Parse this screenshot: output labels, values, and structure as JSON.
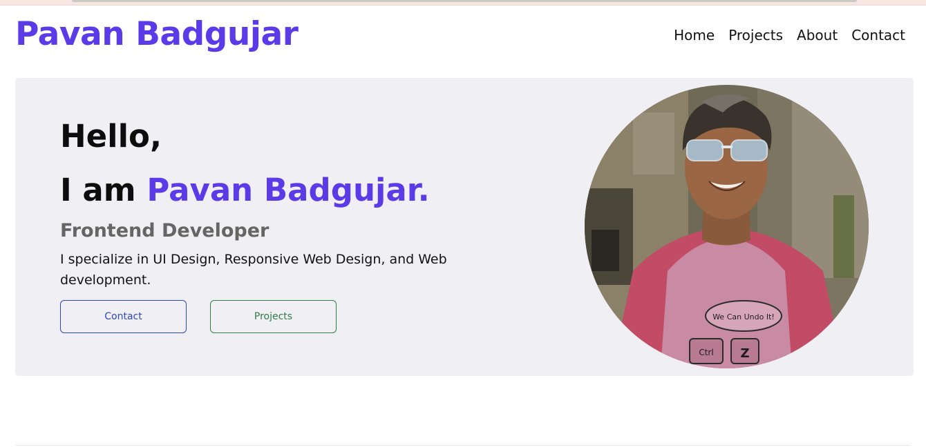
{
  "header": {
    "brand": "Pavan Badgujar",
    "nav": [
      {
        "label": "Home"
      },
      {
        "label": "Projects"
      },
      {
        "label": "About"
      },
      {
        "label": "Contact"
      }
    ]
  },
  "hero": {
    "greeting": "Hello,",
    "intro_prefix": "I am ",
    "intro_name": "Pavan Badgujar.",
    "role": "Frontend Developer",
    "bio": "I specialize in UI Design, Responsive Web Design, and Web development.",
    "buttons": {
      "contact": "Contact",
      "projects": "Projects"
    },
    "photo": {
      "shirt_speech_text": "We Can Undo It!",
      "shirt_key_ctrl": "Ctrl",
      "shirt_key_z": "Z"
    }
  },
  "colors": {
    "accent": "#5b3be8",
    "hero_background": "#f0eff4",
    "contact_button": "#2b47c2",
    "projects_button": "#2f7d44"
  }
}
